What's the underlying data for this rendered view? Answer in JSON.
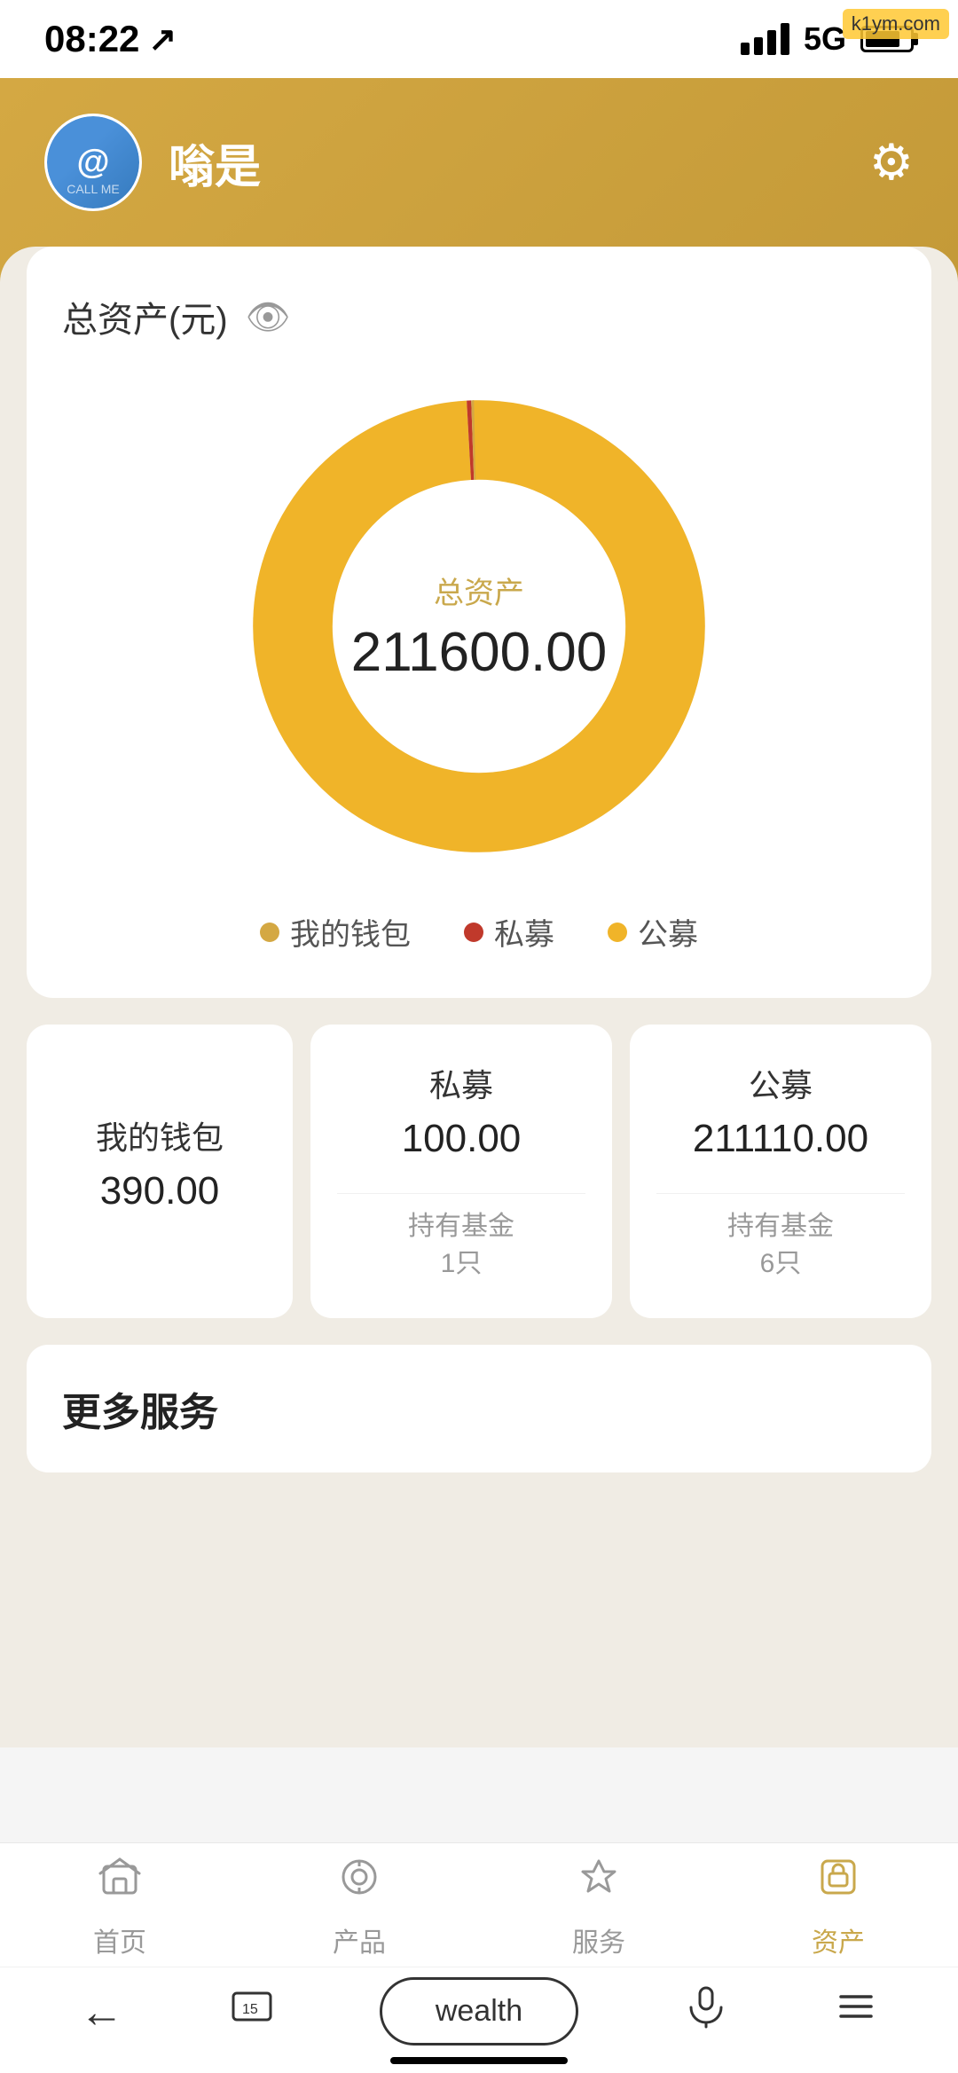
{
  "statusBar": {
    "time": "08:22",
    "network": "5G",
    "navigationIcon": "↗"
  },
  "header": {
    "username": "嗡是",
    "settingsLabel": "设置"
  },
  "assetCard": {
    "title": "总资产(元)",
    "centerLabel": "总资产",
    "totalValue": "211600.00"
  },
  "legend": {
    "items": [
      {
        "label": "我的钱包",
        "color": "#D4A843"
      },
      {
        "label": "私募",
        "color": "#C0392B"
      },
      {
        "label": "公募",
        "color": "#F0B429"
      }
    ]
  },
  "breakdown": {
    "wallet": {
      "title": "我的钱包",
      "value": "390.00"
    },
    "private": {
      "title": "私募",
      "value": "100.00",
      "subLabel": "持有基金",
      "subValue": "1只"
    },
    "public": {
      "title": "公募",
      "value": "211110.00",
      "subLabel": "持有基金",
      "subValue": "6只"
    }
  },
  "moreServices": {
    "title": "更多服务"
  },
  "bottomNav": {
    "items": [
      {
        "label": "首页",
        "icon": "⊞",
        "active": false
      },
      {
        "label": "产品",
        "icon": "◎",
        "active": false
      },
      {
        "label": "服务",
        "icon": "△",
        "active": false
      },
      {
        "label": "资产",
        "icon": "▣",
        "active": true
      }
    ]
  },
  "bottomToolbar": {
    "backLabel": "←",
    "screenshotLabel": "⎘",
    "wealthLabel": "wealth",
    "micLabel": "mic",
    "menuLabel": "≡"
  },
  "watermark": "k1ym.com"
}
